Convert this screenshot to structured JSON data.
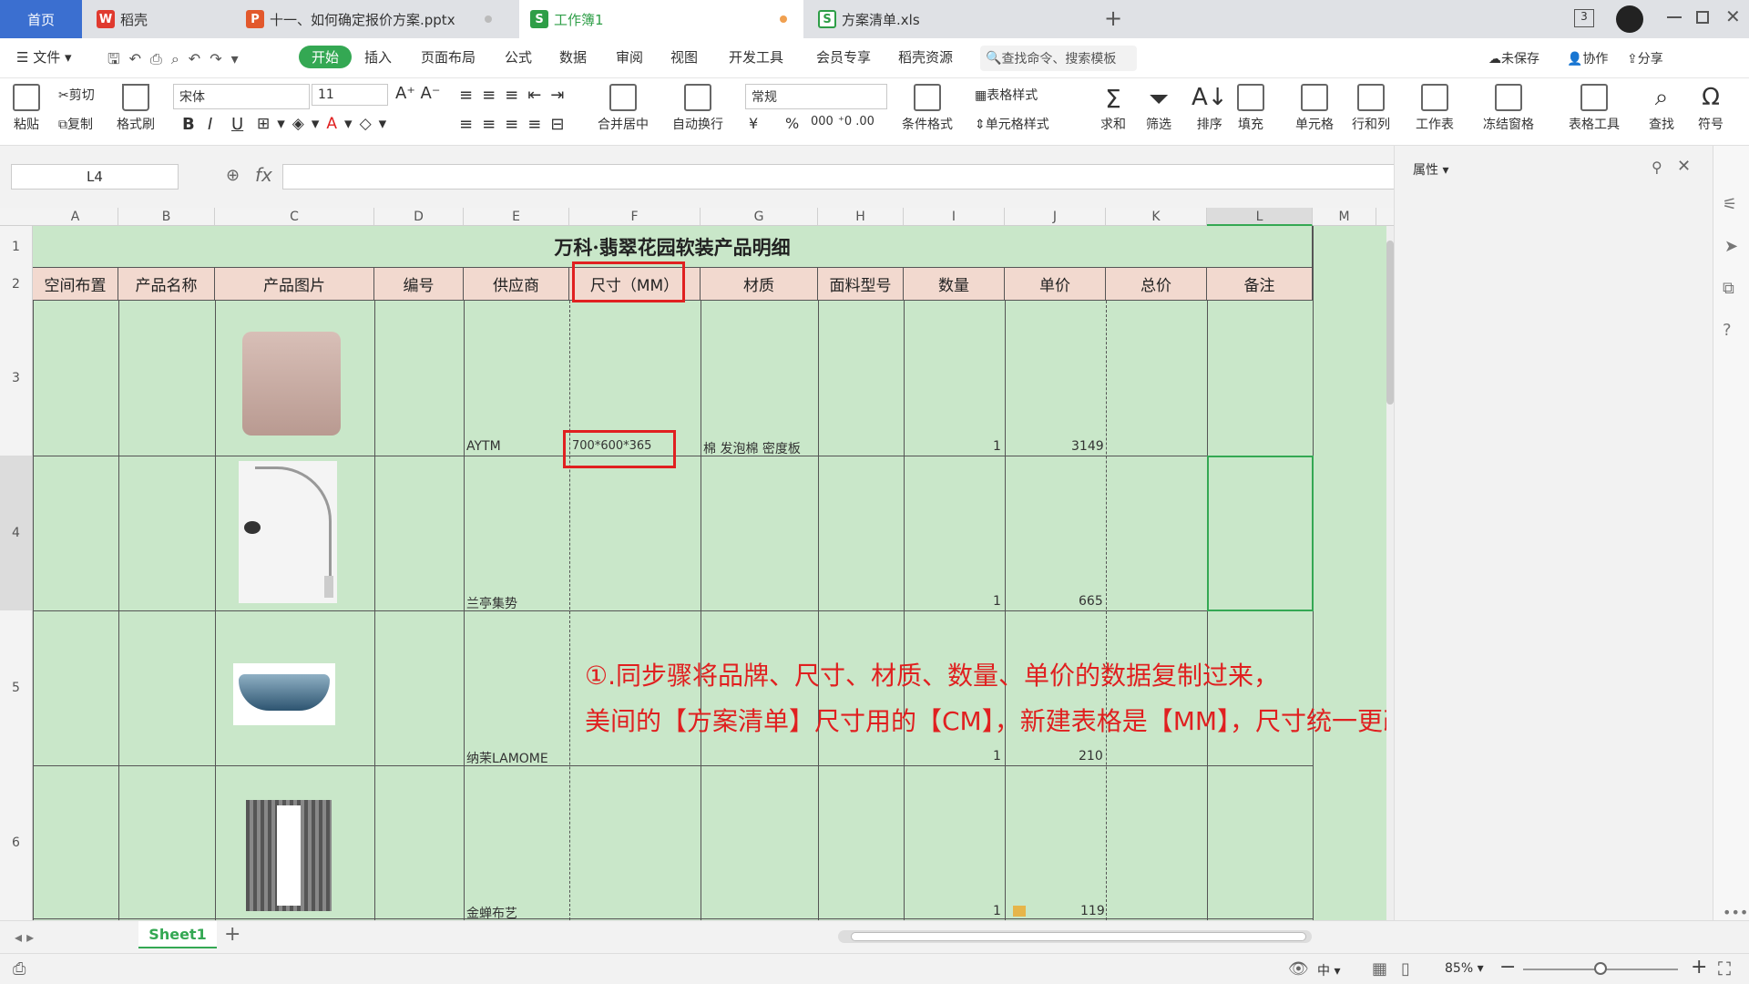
{
  "tabs": [
    {
      "label": "首页"
    },
    {
      "label": "稻壳"
    },
    {
      "label": "十一、如何确定报价方案.pptx"
    },
    {
      "label": "工作簿1"
    },
    {
      "label": "方案清单.xls"
    }
  ],
  "tab_icons": {
    "daoke": "W",
    "pptx": "P",
    "sheet": "S",
    "xls": "S"
  },
  "new_tab_symbol": "+",
  "window_badge": "3",
  "menu": {
    "file": "文件",
    "items": [
      "开始",
      "插入",
      "页面布局",
      "公式",
      "数据",
      "审阅",
      "视图",
      "开发工具",
      "会员专享",
      "稻壳资源"
    ],
    "search_placeholder": "查找命令、搜索模板",
    "unsaved": "未保存",
    "collab": "协作",
    "share": "分享"
  },
  "ribbon": {
    "paste": "粘贴",
    "cut": "剪切",
    "copy": "复制",
    "format_painter": "格式刷",
    "font_name": "宋体",
    "font_size": "11",
    "bold": "B",
    "italic": "I",
    "underline": "U",
    "merge_center": "合并居中",
    "wrap": "自动换行",
    "number_format": "常规",
    "currency": "¥",
    "percent": "%",
    "thousands": "000",
    "cond_format": "条件格式",
    "table_style": "表格样式",
    "cell_style": "单元格样式",
    "sum": "求和",
    "filter": "筛选",
    "sort": "排序",
    "fill": "填充",
    "cell": "单元格",
    "rowcol": "行和列",
    "worksheet": "工作表",
    "freeze": "冻结窗格",
    "table_tools": "表格工具",
    "find": "查找",
    "symbol": "符号"
  },
  "formula_bar": {
    "name_box": "L4",
    "fx": "fx",
    "content": ""
  },
  "properties_title": "属性",
  "columns": [
    "A",
    "B",
    "C",
    "D",
    "E",
    "F",
    "G",
    "H",
    "I",
    "J",
    "K",
    "L",
    "M"
  ],
  "sheet": {
    "title": "万科·翡翠花园软装产品明细",
    "headers": [
      "空间布置",
      "产品名称",
      "产品图片",
      "编号",
      "供应商",
      "尺寸（MM）",
      "材质",
      "面料型号",
      "数量",
      "单价",
      "总价",
      "备注"
    ],
    "rows": [
      {
        "num": "3",
        "supplier": "AYTM",
        "size": "700*600*365",
        "material": "棉 发泡棉 密度板",
        "qty": "1",
        "price": "3149"
      },
      {
        "num": "4",
        "supplier": "兰亭集势",
        "size": "",
        "material": "",
        "qty": "1",
        "price": "665"
      },
      {
        "num": "5",
        "supplier": "纳茉LAMOME",
        "size": "",
        "material": "",
        "qty": "1",
        "price": "210"
      },
      {
        "num": "6",
        "supplier": "金蝉布艺",
        "size": "",
        "material": "",
        "qty": "1",
        "price": "119"
      }
    ],
    "row_labels": [
      "1",
      "2",
      "3",
      "4",
      "5",
      "6"
    ]
  },
  "annotation": {
    "line1": "①.同步骤将品牌、尺寸、材质、数量、单价的数据复制过来，",
    "line2": "美间的【方案清单】尺寸用的【CM】，新建表格是【MM】，尺寸统一更改过来。"
  },
  "sheet_tab": "Sheet1",
  "add_sheet": "+",
  "status": {
    "input_mode": "中",
    "zoom": "85%",
    "zoom_level": 0.5
  },
  "colors": {
    "accent": "#34a853",
    "home_tab": "#3b6fd0",
    "sheet_fill": "#c9e7c9",
    "header_fill": "#f2d9cf",
    "annotation": "#e02020"
  }
}
